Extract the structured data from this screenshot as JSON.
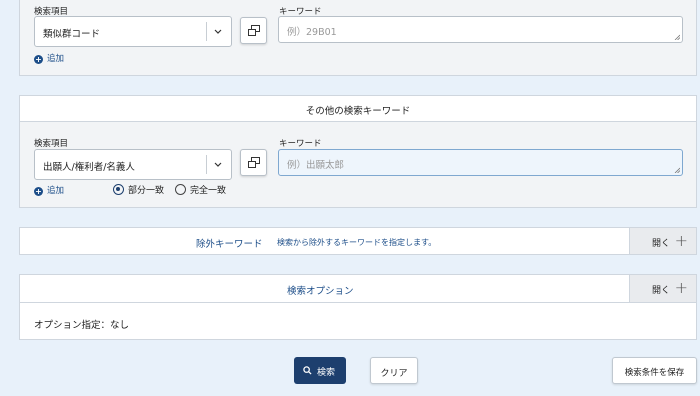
{
  "section1": {
    "field_label": "検索項目",
    "select_value": "類似群コード",
    "keyword_label": "キーワード",
    "keyword_placeholder": "例）29B01",
    "add_label": "追加"
  },
  "section2": {
    "title": "その他の検索キーワード",
    "field_label": "検索項目",
    "select_value": "出願人/権利者/名義人",
    "keyword_label": "キーワード",
    "keyword_placeholder": "例）出願太郎",
    "add_label": "追加",
    "radio_options": [
      {
        "label": "部分一致",
        "selected": true
      },
      {
        "label": "完全一致",
        "selected": false
      }
    ]
  },
  "exclude": {
    "title": "除外キーワード",
    "description": "検索から除外するキーワードを指定します。",
    "open_label": "開く"
  },
  "options": {
    "title": "検索オプション",
    "open_label": "開く",
    "summary": "オプション指定：なし"
  },
  "actions": {
    "search_label": "検索",
    "clear_label": "クリア",
    "save_label": "検索条件を保存"
  },
  "colors": {
    "accent": "#1d3f6e",
    "link": "#1d4e89",
    "background": "#e8f1fa"
  },
  "icons": [
    "copy-icon",
    "chevron-down-icon",
    "plus-circle-icon",
    "plus-icon",
    "search-icon"
  ]
}
